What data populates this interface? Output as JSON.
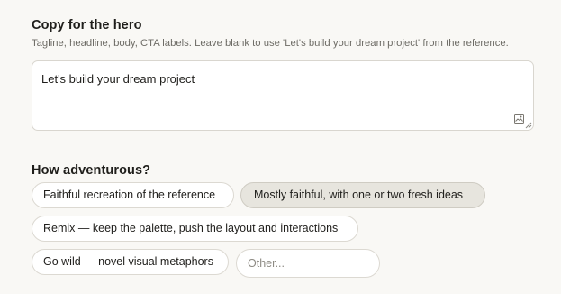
{
  "copy_section": {
    "title": "Copy for the hero",
    "help_text": "Tagline, headline, body, CTA labels. Leave blank to use 'Let's build your dream project' from the reference.",
    "textarea_value": "Let's build your dream project",
    "image_icon": "image-icon",
    "resize_icon": "resize-handle-icon"
  },
  "adventure_section": {
    "title": "How adventurous?",
    "options": [
      {
        "label": "Faithful recreation of the reference",
        "selected": false
      },
      {
        "label": "Mostly faithful, with one or two fresh ideas",
        "selected": true
      },
      {
        "label": "Remix — keep the palette, push the layout and interactions",
        "selected": false
      },
      {
        "label": "Go wild — novel visual metaphors",
        "selected": false
      }
    ],
    "other_placeholder": "Other..."
  },
  "colors": {
    "background": "#f9f8f5",
    "selected_chip": "#e7e5de",
    "border": "#dcd9d2",
    "muted_text": "#6e6c66"
  }
}
